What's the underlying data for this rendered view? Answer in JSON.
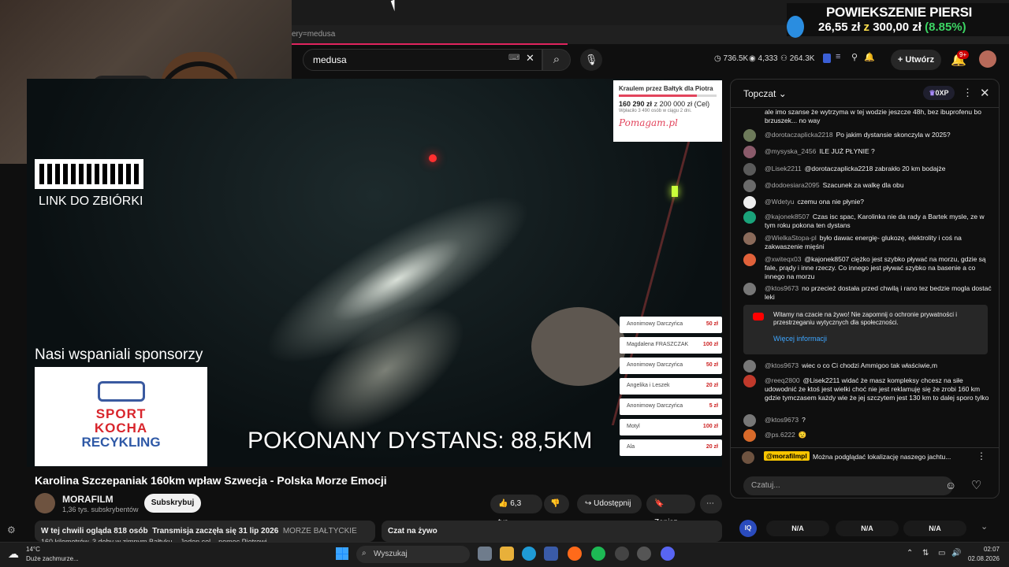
{
  "browser": {
    "url_fragment": "ery=medusa"
  },
  "header": {
    "search_value": "medusa",
    "stats": [
      {
        "icon": "clock-icon",
        "value": "736.5K"
      },
      {
        "icon": "eye-icon",
        "value": "4,333"
      },
      {
        "icon": "people-icon",
        "value": "264.3K"
      }
    ],
    "create_label": "Utwórz",
    "notif_count": "9+"
  },
  "overlay": {
    "title": "POWIEKSZENIE PIERSI",
    "price_current": "26,55 zł",
    "price_sep": "z",
    "price_goal": "300,00 zł",
    "price_pct": "(8.85%)",
    "icon": "arrow-icon"
  },
  "video": {
    "qr_label": "LINK DO ZBIÓRKI",
    "sponsors_label": "Nasi wspaniali sponsorzy",
    "sponsor_logo_lines": [
      "SPORT",
      "KOCHA",
      "RECYKLING"
    ],
    "distance_text": "POKONANY DYSTANS: 88,5KM",
    "fundraiser": {
      "title": "Kraulem przez Bałtyk dla Piotra",
      "raised": "160 290 zł",
      "goal_text": "z 200 000 zł (Cel)",
      "progress": 0.8,
      "sub": "Wpłaciło 3 490 osób w ciągu 2 dni.",
      "brand": "Pomagam.pl"
    },
    "donors": [
      {
        "name": "Anonimowy Darczyńca",
        "amount": "50 zł"
      },
      {
        "name": "Magdalena FRASZCZAK",
        "amount": "100 zł"
      },
      {
        "name": "Anonimowy Darczyńca",
        "amount": "50 zł"
      },
      {
        "name": "Angelika i Leszek",
        "amount": "20 zł"
      },
      {
        "name": "Anonimowy Darczyńca",
        "amount": "5 zł"
      },
      {
        "name": "Motyl",
        "amount": "100 zł"
      },
      {
        "name": "Ala",
        "amount": "20 zł"
      }
    ]
  },
  "info": {
    "title": "Karolina Szczepaniak 160km wpław Szwecja - Polska Morze Emocji",
    "channel": "MORAFILM",
    "subs": "1,36 tys. subskrybentów",
    "subscribe_label": "Subskrybuj",
    "likes": "6,3 tys.",
    "share_label": "Udostępnij",
    "save_label": "Zapisz",
    "desc_line1_a": "W tej chwili ogląda 818 osób",
    "desc_line1_b": "Transmisja zaczęła się 31 lip 2026",
    "desc_line1_c": "MORZE BAŁTYCKIE",
    "desc_line2": "160 kilometrów, 3 doby w zimnym Bałtyku – Jeden cel – pomoc Piotrowi",
    "livechat_label": "Czat na żywo"
  },
  "chat": {
    "title": "Topczat",
    "xp": "0XP",
    "messages": [
      {
        "user": "",
        "text": "ale imo szanse że wytrzyma w tej wodzie jeszcze 48h, bez ibuprofenu bo brzuszek... no way",
        "color": "#7a6b5a"
      },
      {
        "user": "@dorotaczaplicka2218",
        "text": "Po jakim dystansie skonczyla w 2025?",
        "color": "#6d7a5a"
      },
      {
        "user": "@mysyska_2456",
        "text": "ILE JUŻ PŁYNIE ?",
        "color": "#8a5a6a"
      },
      {
        "user": "@Lisek2211",
        "text": "@dorotaczaplicka2218 zabrakło 20 km bodajże",
        "color": "#5a5a5a"
      },
      {
        "user": "@dodoesiara2095",
        "text": "Szacunek za walkę dla obu",
        "color": "#6a6a6a"
      },
      {
        "user": "@Wdetyu",
        "text": "czemu ona nie płynie?",
        "color": "#eeeeee"
      },
      {
        "user": "@kajonek8507",
        "text": "Czas isc spac, Karolinka nie da rady a Bartek mysle, ze w tym roku pokona ten dystans",
        "color": "#1aa37a"
      },
      {
        "user": "@WielkaStopa-pl",
        "text": "było dawac energię- glukozę, elektrolity i coś na zakwaszenie mięśni",
        "color": "#8a6a5a"
      },
      {
        "user": "@xwiteqx03",
        "text": "@kajonek8507 ciężko jest szybko pływać na morzu, gdzie są fale, prądy i inne rzeczy. Co innego jest pływać szybko na basenie a co innego na morzu",
        "color": "#e0613a"
      },
      {
        "user": "@ktos9673",
        "text": "no przecież dostała przed chwilą i rano tez bedzie mogla dostać leki",
        "color": "#777777"
      },
      {
        "user": "@ktos9673",
        "text": "wiec o co Ci chodzi Ammigoo tak właściwie,m",
        "color": "#777777"
      },
      {
        "user": "@reeq2800",
        "text": "@Lisek2211 widać że masz kompleksy chcesz na siłe udowodnić że ktoś jest wielki choć nie jest reklamuję się że zrobi 160 km gdzie tymczasem każdy wie że jej szczytem jest 130 km to dalej sporo tylko",
        "color": "#c0392b"
      },
      {
        "user": "@ktos9673",
        "text": "?",
        "color": "#777777"
      },
      {
        "user": "@ps.6222",
        "text": "😟",
        "color": "#d86a2a"
      }
    ],
    "notice_text": "Witamy na czacie na żywo! Nie zapomnij o ochronie prywatności i przestrzeganiu wytycznych dla społeczności.",
    "notice_link": "Więcej informacji",
    "pinned_user": "@morafilmpl",
    "pinned_text": "Można podglądać lokalizację naszego jachtu...",
    "input_placeholder": "Czatuj..."
  },
  "extension": {
    "logo": "IQ",
    "values": [
      "N/A",
      "N/A",
      "N/A"
    ]
  },
  "taskbar": {
    "temp": "14°C",
    "weather": "Duże zachmurze...",
    "search_label": "Wyszukaj",
    "time": "02:07",
    "date": "02.08.2026"
  }
}
